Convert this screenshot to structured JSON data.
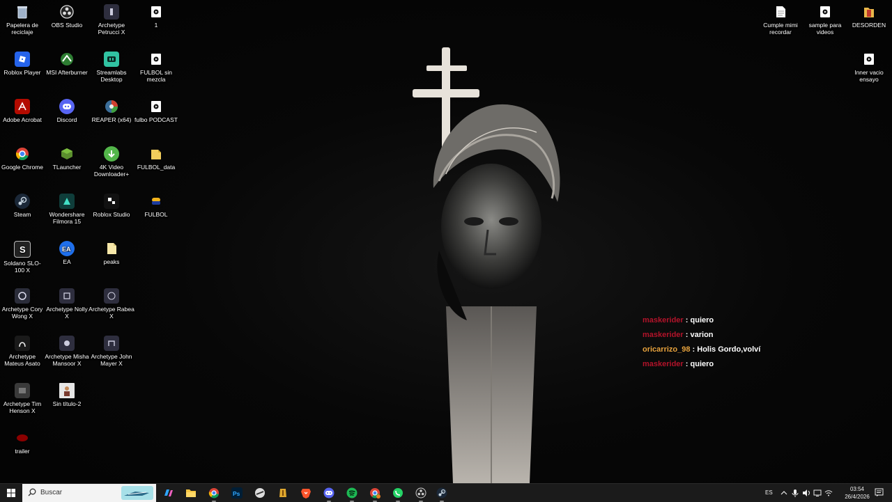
{
  "desktop": {
    "icons": [
      {
        "label": "Papelera de reciclaje",
        "icon": "recycle-bin-icon"
      },
      {
        "label": "Roblox Player",
        "icon": "roblox-icon"
      },
      {
        "label": "Adobe Acrobat",
        "icon": "acrobat-icon"
      },
      {
        "label": "Google Chrome",
        "icon": "chrome-icon"
      },
      {
        "label": "Steam",
        "icon": "steam-icon"
      },
      {
        "label": "Soldano SLO-100 X",
        "icon": "archetype-icon"
      },
      {
        "label": "Archetype Cory Wong X",
        "icon": "archetype-icon"
      },
      {
        "label": "Archetype Mateus Asato",
        "icon": "archetype-icon"
      },
      {
        "label": "Archetype Tim Henson X",
        "icon": "archetype-icon"
      },
      {
        "label": "trailer",
        "icon": "video-icon"
      },
      {
        "label": "OBS Studio",
        "icon": "obs-icon"
      },
      {
        "label": "MSI Afterburner",
        "icon": "afterburner-icon"
      },
      {
        "label": "Discord",
        "icon": "discord-icon"
      },
      {
        "label": "TLauncher",
        "icon": "tlauncher-icon"
      },
      {
        "label": "Wondershare Filmora 15",
        "icon": "filmora-icon"
      },
      {
        "label": "EA",
        "icon": "ea-icon"
      },
      {
        "label": "Archetype Nolly X",
        "icon": "archetype-icon"
      },
      {
        "label": "Archetype Misha Mansoor X",
        "icon": "archetype-icon"
      },
      {
        "label": "Sin título-2",
        "icon": "image-icon"
      },
      {
        "label": "Archetype Petrucci X",
        "icon": "archetype-icon"
      },
      {
        "label": "Streamlabs Desktop",
        "icon": "streamlabs-icon"
      },
      {
        "label": "REAPER (x64)",
        "icon": "reaper-icon"
      },
      {
        "label": "4K Video Downloader+",
        "icon": "4k-downloader-icon"
      },
      {
        "label": "Roblox Studio",
        "icon": "roblox-studio-icon"
      },
      {
        "label": "peaks",
        "icon": "file-icon"
      },
      {
        "label": "Archetype Rabea X",
        "icon": "archetype-icon"
      },
      {
        "label": "Archetype John Mayer X",
        "icon": "archetype-icon"
      },
      {
        "label": "1",
        "icon": "media-file-icon"
      },
      {
        "label": "FULBOL sin mezcla",
        "icon": "media-file-icon"
      },
      {
        "label": "fulbo PODCAST",
        "icon": "media-file-icon"
      },
      {
        "label": "FULBOL_data",
        "icon": "folder-icon"
      },
      {
        "label": "FULBOL",
        "icon": "game-icon"
      },
      {
        "label": "Cumple mimi recordar",
        "icon": "document-icon"
      },
      {
        "label": "sample para videos",
        "icon": "media-file-icon"
      },
      {
        "label": "DESORDEN",
        "icon": "folder-icon"
      },
      {
        "label": "Inner vacio ensayo",
        "icon": "media-file-icon"
      }
    ]
  },
  "chat": [
    {
      "user": "maskerider",
      "sep": " : ",
      "msg": "quiero",
      "color": "#b3132a"
    },
    {
      "user": "maskerider",
      "sep": " : ",
      "msg": "varion",
      "color": "#b3132a"
    },
    {
      "user": "oricarrizo_98",
      "sep": " : ",
      "msg": "Holis Gordo,volví",
      "color": "#e8a33d"
    },
    {
      "user": "maskerider",
      "sep": " : ",
      "msg": "quiero",
      "color": "#b3132a"
    }
  ],
  "taskbar": {
    "search_placeholder": "Buscar",
    "apps": [
      "copilot-icon",
      "file-explorer-icon",
      "chrome-icon",
      "photoshop-icon",
      "app-icon",
      "app-icon",
      "brave-icon",
      "discord-icon",
      "spotify-icon",
      "chrome-profile-icon",
      "whatsapp-icon",
      "obs-icon",
      "steam-icon"
    ]
  },
  "tray": {
    "language": "ES",
    "time": "03:54",
    "date": "26/4/2026"
  },
  "colors": {
    "taskbar": "#1b1b1b",
    "chat_user": "#b3132a",
    "chat_user_alt": "#e8a33d"
  }
}
